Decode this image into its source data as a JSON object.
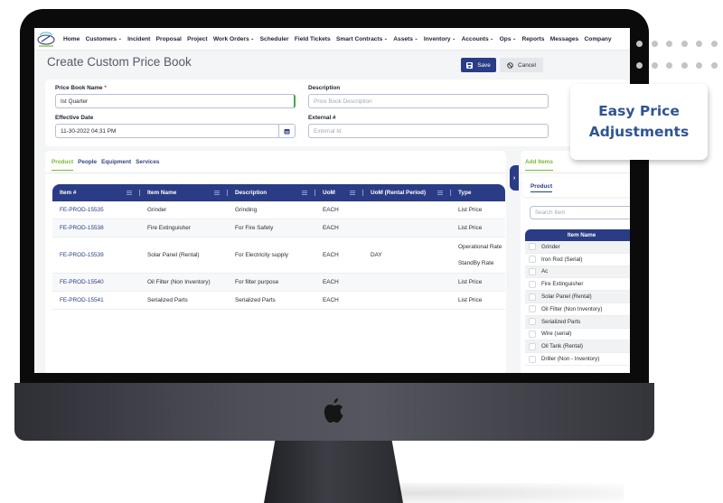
{
  "app": {
    "nav": [
      {
        "label": "Home",
        "dropdown": false
      },
      {
        "label": "Customers",
        "dropdown": true
      },
      {
        "label": "Incident",
        "dropdown": false
      },
      {
        "label": "Proposal",
        "dropdown": false
      },
      {
        "label": "Project",
        "dropdown": false
      },
      {
        "label": "Work Orders",
        "dropdown": true
      },
      {
        "label": "Scheduler",
        "dropdown": false
      },
      {
        "label": "Field Tickets",
        "dropdown": false
      },
      {
        "label": "Smart Contracts",
        "dropdown": true
      },
      {
        "label": "Assets",
        "dropdown": true
      },
      {
        "label": "Inventory",
        "dropdown": true
      },
      {
        "label": "Accounts",
        "dropdown": true
      },
      {
        "label": "Ops",
        "dropdown": true
      },
      {
        "label": "Reports",
        "dropdown": false
      },
      {
        "label": "Messages",
        "dropdown": false
      },
      {
        "label": "Company",
        "dropdown": false
      }
    ],
    "caret": "⌄"
  },
  "page": {
    "title": "Create Custom Price Book",
    "save_label": "Save",
    "cancel_label": "Cancel"
  },
  "form": {
    "name_label": "Price Book Name",
    "required_mark": "*",
    "name_value": "Ist Quarter",
    "date_label": "Effective Date",
    "date_value": "11-30-2022 04:31 PM",
    "description_label": "Description",
    "description_placeholder": "Price Book Description",
    "external_label": "External #",
    "external_placeholder": "External Id"
  },
  "tabs": [
    {
      "label": "Product",
      "active": true
    },
    {
      "label": "People",
      "active": false
    },
    {
      "label": "Equipment",
      "active": false
    },
    {
      "label": "Services",
      "active": false
    }
  ],
  "grid": {
    "columns": [
      "Item #",
      "Item Name",
      "Description",
      "UoM",
      "UoM (Rental Period)",
      "Type"
    ],
    "rows": [
      {
        "item": "FE-PROD-15535",
        "name": "Grinder",
        "description": "Grinding",
        "uom": "EACH",
        "rental": "",
        "types": [
          "List Price"
        ]
      },
      {
        "item": "FE-PROD-15538",
        "name": "Fire Extinguisher",
        "description": "For Fire Safety",
        "uom": "EACH",
        "rental": "",
        "types": [
          "List Price"
        ]
      },
      {
        "item": "FE-PROD-15539",
        "name": "Solar Panel (Rental)",
        "description": "For Electricity supply",
        "uom": "EACH",
        "rental": "DAY",
        "types": [
          "Operational Rate",
          "StandBy Rate"
        ]
      },
      {
        "item": "FE-PROD-15540",
        "name": "Oil Filter (Non Inventory)",
        "description": "For filter purpose",
        "uom": "EACH",
        "rental": "",
        "types": [
          "List Price"
        ]
      },
      {
        "item": "FE-PROD-15541",
        "name": "Serialized Parts",
        "description": "Serialized Parts",
        "uom": "EACH",
        "rental": "",
        "types": [
          "List Price"
        ]
      }
    ]
  },
  "side_panel": {
    "collapse_glyph": "›",
    "title": "Add Items",
    "subtab": "Product",
    "search_placeholder": "Search Item",
    "column": "Item Name",
    "items": [
      "Grinder",
      "Iron Rod (Serial)",
      "Ac",
      "Fire Extinguisher",
      "Solar Panel (Rental)",
      "Oil Filter (Non Inventory)",
      "Serialized Parts",
      "Wire (serial)",
      "Oil Tank (Rental)",
      "Driller (Non - Inventory)"
    ]
  },
  "callout": {
    "line1": "Easy Price",
    "line2": "Adjustments"
  },
  "colors": {
    "primary": "#2a3c85",
    "accent_green": "#7cb832",
    "callout_text": "#2f5591"
  }
}
